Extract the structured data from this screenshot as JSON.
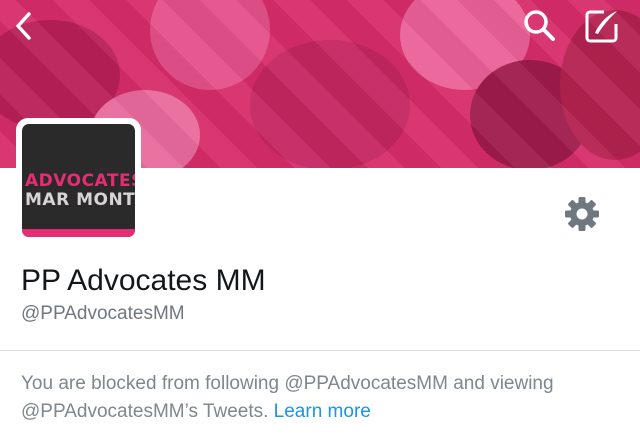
{
  "header": {
    "back_icon": "chevron-left-icon",
    "search_icon": "search-icon",
    "compose_icon": "compose-icon",
    "banner_color": "#d62c6a"
  },
  "avatar": {
    "line1": "ADVOCATES",
    "line2": "MAR MONTE"
  },
  "profile": {
    "display_name": "PP Advocates MM",
    "handle": "@PPAdvocatesMM",
    "settings_icon": "gear-icon"
  },
  "blocked": {
    "message": "You are blocked from following @PPAdvocatesMM and viewing @PPAdvocatesMM’s Tweets.",
    "link_label": "Learn more",
    "link_color": "#1b95e0"
  }
}
